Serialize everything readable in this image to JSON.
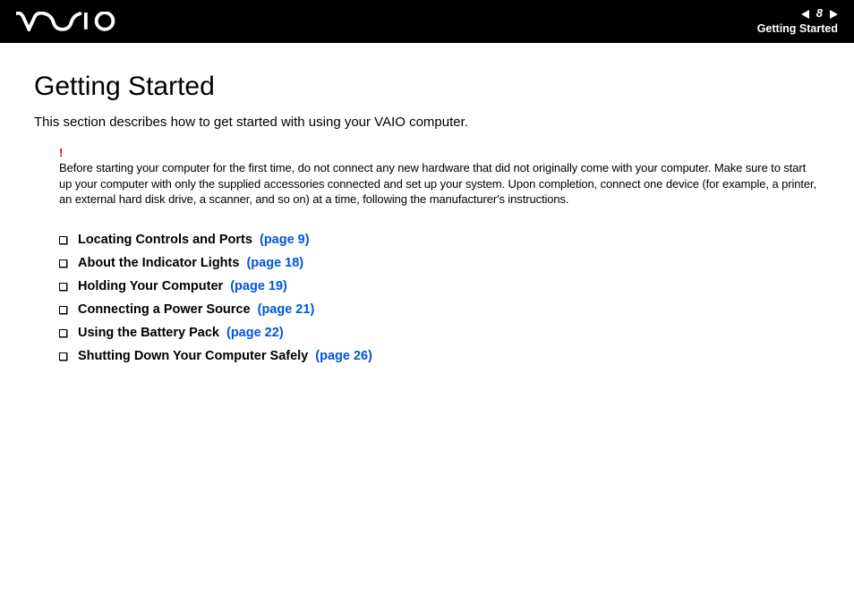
{
  "header": {
    "page_number": "8",
    "section": "Getting Started"
  },
  "page": {
    "title": "Getting Started",
    "intro": "This section describes how to get started with using your VAIO computer.",
    "warning_mark": "!",
    "warning_text": "Before starting your computer for the first time, do not connect any new hardware that did not originally come with your computer. Make sure to start up your computer with only the supplied accessories connected and set up your system. Upon completion, connect one device (for example, a printer, an external hard disk drive, a scanner, and so on) at a time, following the manufacturer's instructions."
  },
  "toc": [
    {
      "label": "Locating Controls and Ports",
      "page_ref": "(page 9)"
    },
    {
      "label": "About the Indicator Lights",
      "page_ref": "(page 18)"
    },
    {
      "label": "Holding Your Computer",
      "page_ref": "(page 19)"
    },
    {
      "label": "Connecting a Power Source",
      "page_ref": "(page 21)"
    },
    {
      "label": "Using the Battery Pack",
      "page_ref": "(page 22)"
    },
    {
      "label": "Shutting Down Your Computer Safely",
      "page_ref": "(page 26)"
    }
  ]
}
